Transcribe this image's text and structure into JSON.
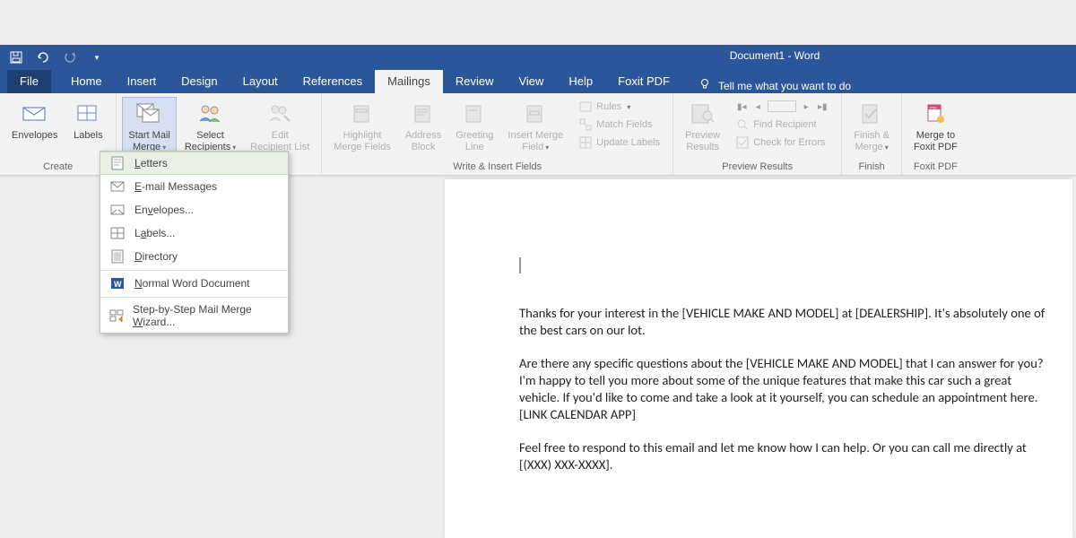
{
  "app_title": "Document1  -  Word",
  "tabs": [
    "File",
    "Home",
    "Insert",
    "Design",
    "Layout",
    "References",
    "Mailings",
    "Review",
    "View",
    "Help",
    "Foxit PDF"
  ],
  "active_tab": "Mailings",
  "tellme": "Tell me what you want to do",
  "groups": {
    "create": {
      "name": "Create",
      "envelopes": "Envelopes",
      "labels": "Labels"
    },
    "start": {
      "name": "Start Mail Merge",
      "startmm": "Start Mail\nMerge",
      "select": "Select\nRecipients",
      "edit": "Edit\nRecipient List"
    },
    "write": {
      "name": "Write & Insert Fields",
      "highlight": "Highlight\nMerge Fields",
      "address": "Address\nBlock",
      "greeting": "Greeting\nLine",
      "insertmf": "Insert Merge\nField",
      "rules": "Rules",
      "match": "Match Fields",
      "update": "Update Labels"
    },
    "preview": {
      "name": "Preview Results",
      "preview": "Preview\nResults",
      "find": "Find Recipient",
      "check": "Check for Errors"
    },
    "finish": {
      "name": "Finish",
      "finish": "Finish &\nMerge"
    },
    "foxit": {
      "name": "Foxit PDF",
      "merge": "Merge to\nFoxit PDF"
    }
  },
  "dropdown": {
    "letters": "Letters",
    "email": "E-mail Messages",
    "envelopes": "Envelopes...",
    "labels": "Labels...",
    "directory": "Directory",
    "normal": "Normal Word Document",
    "wizard": "Step-by-Step Mail Merge Wizard..."
  },
  "document": {
    "p1": "Thanks for your interest in the [VEHICLE MAKE AND MODEL] at [DEALERSHIP]. It's absolutely one of the best cars on our lot.",
    "p2": "Are there any specific questions about the [VEHICLE MAKE AND MODEL] that I can answer for you? I'm happy to tell you more about some of the unique features that make this car such a great vehicle. If you'd like to come and take a look at it yourself, you can schedule an appointment here. [LINK CALENDAR APP]",
    "p3": "Feel free to respond to this email and let me know how I can help. Or you can call me directly at [(XXX) XXX-XXXX]."
  }
}
